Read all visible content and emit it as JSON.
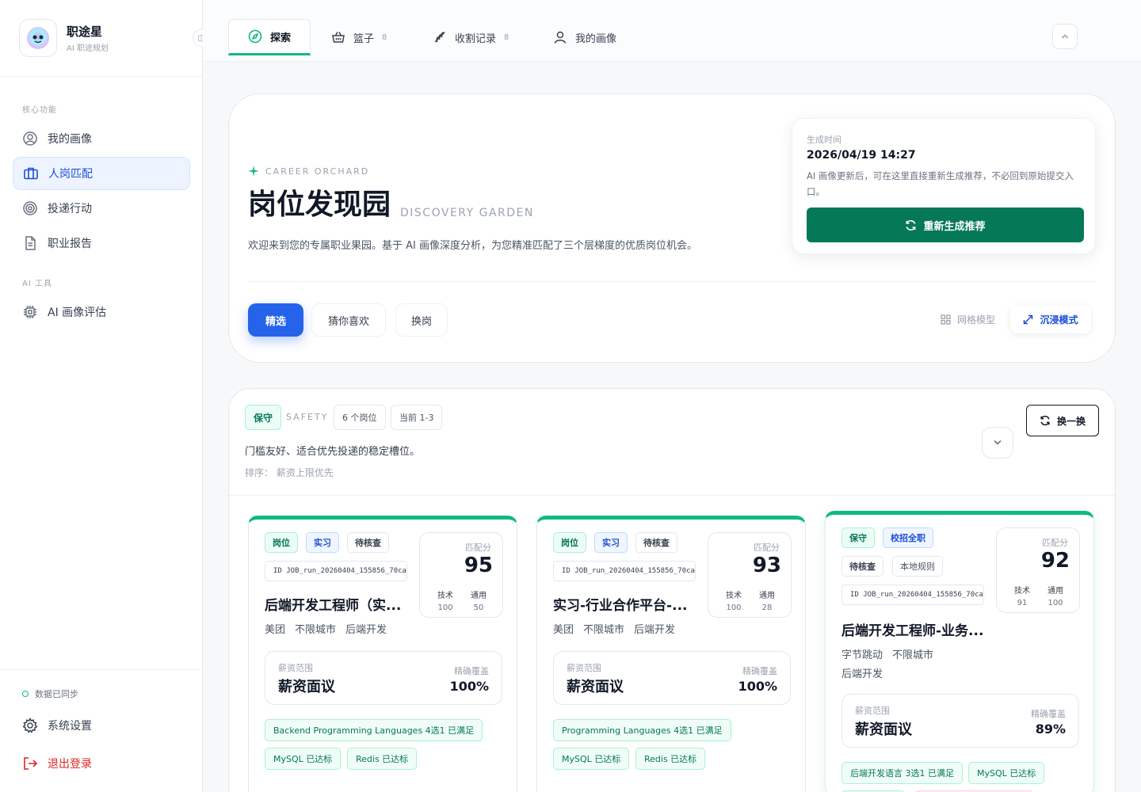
{
  "brand": {
    "name": "职途星",
    "subtitle": "AI 职途规划",
    "collapse_glyph": "◫"
  },
  "sidebar": {
    "sections": [
      "核心功能",
      "AI 工具"
    ],
    "items": [
      {
        "label": "我的画像",
        "icon": "user-circle-icon"
      },
      {
        "label": "人岗匹配",
        "icon": "briefcase-icon",
        "active": true
      },
      {
        "label": "投递行动",
        "icon": "target-icon"
      },
      {
        "label": "职业报告",
        "icon": "document-icon"
      },
      {
        "label": "AI 画像评估",
        "icon": "chip-icon"
      }
    ],
    "sync_status": "数据已同步",
    "settings": "系统设置",
    "logout": "退出登录"
  },
  "tabs": [
    {
      "label": "探索",
      "icon": "compass-icon",
      "active": true
    },
    {
      "label": "篮子",
      "icon": "basket-icon",
      "count": "8"
    },
    {
      "label": "收割记录",
      "icon": "harvest-icon",
      "count": "8"
    },
    {
      "label": "我的画像",
      "icon": "user-icon"
    }
  ],
  "hero": {
    "eyebrow": "CAREER ORCHARD",
    "title": "岗位发现园",
    "title_en": "DISCOVERY GARDEN",
    "description": "欢迎来到您的专属职业果园。基于 AI 画像深度分析，为您精准匹配了三个层梯度的优质岗位机会。",
    "gen_label": "生成时间",
    "gen_time": "2026/04/19 14:27",
    "gen_desc": "AI 画像更新后，可在这里直接重新生成推荐，不必回到原始提交入口。",
    "regen_label": "重新生成推荐",
    "filters": [
      "精选",
      "猜你喜欢",
      "换岗"
    ],
    "view_grid": "网格模型",
    "view_immerse": "沉浸模式"
  },
  "section": {
    "tier": "保守",
    "tier_en": "SAFETY",
    "count": "6 个岗位",
    "range": "当前 1-3",
    "description": "门槛友好、适合优先投递的稳定槽位。",
    "sort": "排序：  薪资上限优先",
    "swap_label": "换一换"
  },
  "cards": [
    {
      "tags": [
        "岗位",
        "实习",
        "待核查"
      ],
      "id": "ID  JOB_run_20260404_155856_70ca",
      "score_label": "匹配分",
      "score": "95",
      "tech_label": "技术",
      "tech": "100",
      "general_label": "通用",
      "general": "50",
      "title": "后端开发工程师（实...",
      "meta": [
        "美团",
        "不限城市",
        "后端开发"
      ],
      "salary_label": "薪资范围",
      "salary": "薪资面议",
      "coverage_label": "精确覆盖",
      "coverage": "100%",
      "skills": [
        "Backend Programming Languages 4选1 已满足",
        "MySQL 已达标",
        "Redis 已达标"
      ]
    },
    {
      "tags": [
        "岗位",
        "实习",
        "待核查"
      ],
      "id": "ID  JOB_run_20260404_155856_70ca",
      "score_label": "匹配分",
      "score": "93",
      "tech_label": "技术",
      "tech": "100",
      "general_label": "通用",
      "general": "28",
      "title": "实习-行业合作平台-...",
      "meta": [
        "美团",
        "不限城市",
        "后端开发"
      ],
      "salary_label": "薪资范围",
      "salary": "薪资面议",
      "coverage_label": "精确覆盖",
      "coverage": "100%",
      "skills": [
        "Programming Languages 4选1 已满足",
        "MySQL 已达标",
        "Redis 已达标"
      ]
    },
    {
      "tags": [
        "保守",
        "校招全职",
        "待核查",
        "本地规则"
      ],
      "id": "ID  JOB_run_20260404_155856_70ca",
      "score_label": "匹配分",
      "score": "92",
      "tech_label": "技术",
      "tech": "91",
      "general_label": "通用",
      "general": "100",
      "title": "后端开发工程师-业务...",
      "meta": [
        "字节跳动",
        "不限城市",
        "后端开发"
      ],
      "salary_label": "薪资范围",
      "salary": "薪资面议",
      "coverage_label": "精确覆盖",
      "coverage": "89%",
      "skills": [
        "后端开发语言 3选1 已满足",
        "MySQL 已达标"
      ]
    }
  ],
  "colors": {
    "accent_green": "#10b981",
    "primary_blue": "#2563eb",
    "dark_green": "#047857",
    "danger": "#dc2626"
  }
}
